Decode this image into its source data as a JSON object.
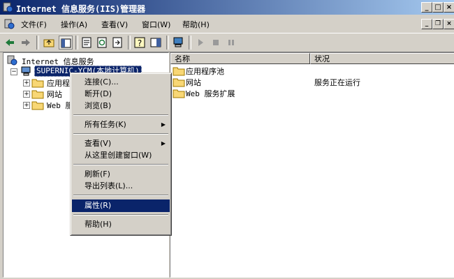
{
  "window": {
    "title": "Internet 信息服务(IIS)管理器"
  },
  "menubar": {
    "items": [
      {
        "label": "文件(F)"
      },
      {
        "label": "操作(A)"
      },
      {
        "label": "查看(V)"
      },
      {
        "label": "窗口(W)"
      },
      {
        "label": "帮助(H)"
      }
    ]
  },
  "tree": {
    "root_label": "Internet 信息服务",
    "server_label": "SUPERNIC-YCM(本地计算机)",
    "children": [
      {
        "label": "应用程"
      },
      {
        "label": "网站"
      },
      {
        "label": "Web 服"
      }
    ]
  },
  "list": {
    "columns": [
      "名称",
      "状况"
    ],
    "rows": [
      {
        "name": "应用程序池",
        "status": ""
      },
      {
        "name": "网站",
        "status": "服务正在运行"
      },
      {
        "name": "Web 服务扩展",
        "status": ""
      }
    ]
  },
  "context_menu": {
    "items": [
      {
        "label": "连接(C)..."
      },
      {
        "label": "断开(D)"
      },
      {
        "label": "浏览(B)"
      },
      {
        "label": "所有任务(K)"
      },
      {
        "label": "查看(V)"
      },
      {
        "label": "从这里创建窗口(W)"
      },
      {
        "label": "刷新(F)"
      },
      {
        "label": "导出列表(L)..."
      },
      {
        "label": "属性(R)"
      },
      {
        "label": "帮助(H)"
      }
    ],
    "highlighted_index": 8
  },
  "colors": {
    "selection": "#0a246a",
    "titlebar_start": "#0a246a",
    "titlebar_end": "#a6caf0",
    "face": "#d4d0c8",
    "folder": "#f8d775"
  }
}
